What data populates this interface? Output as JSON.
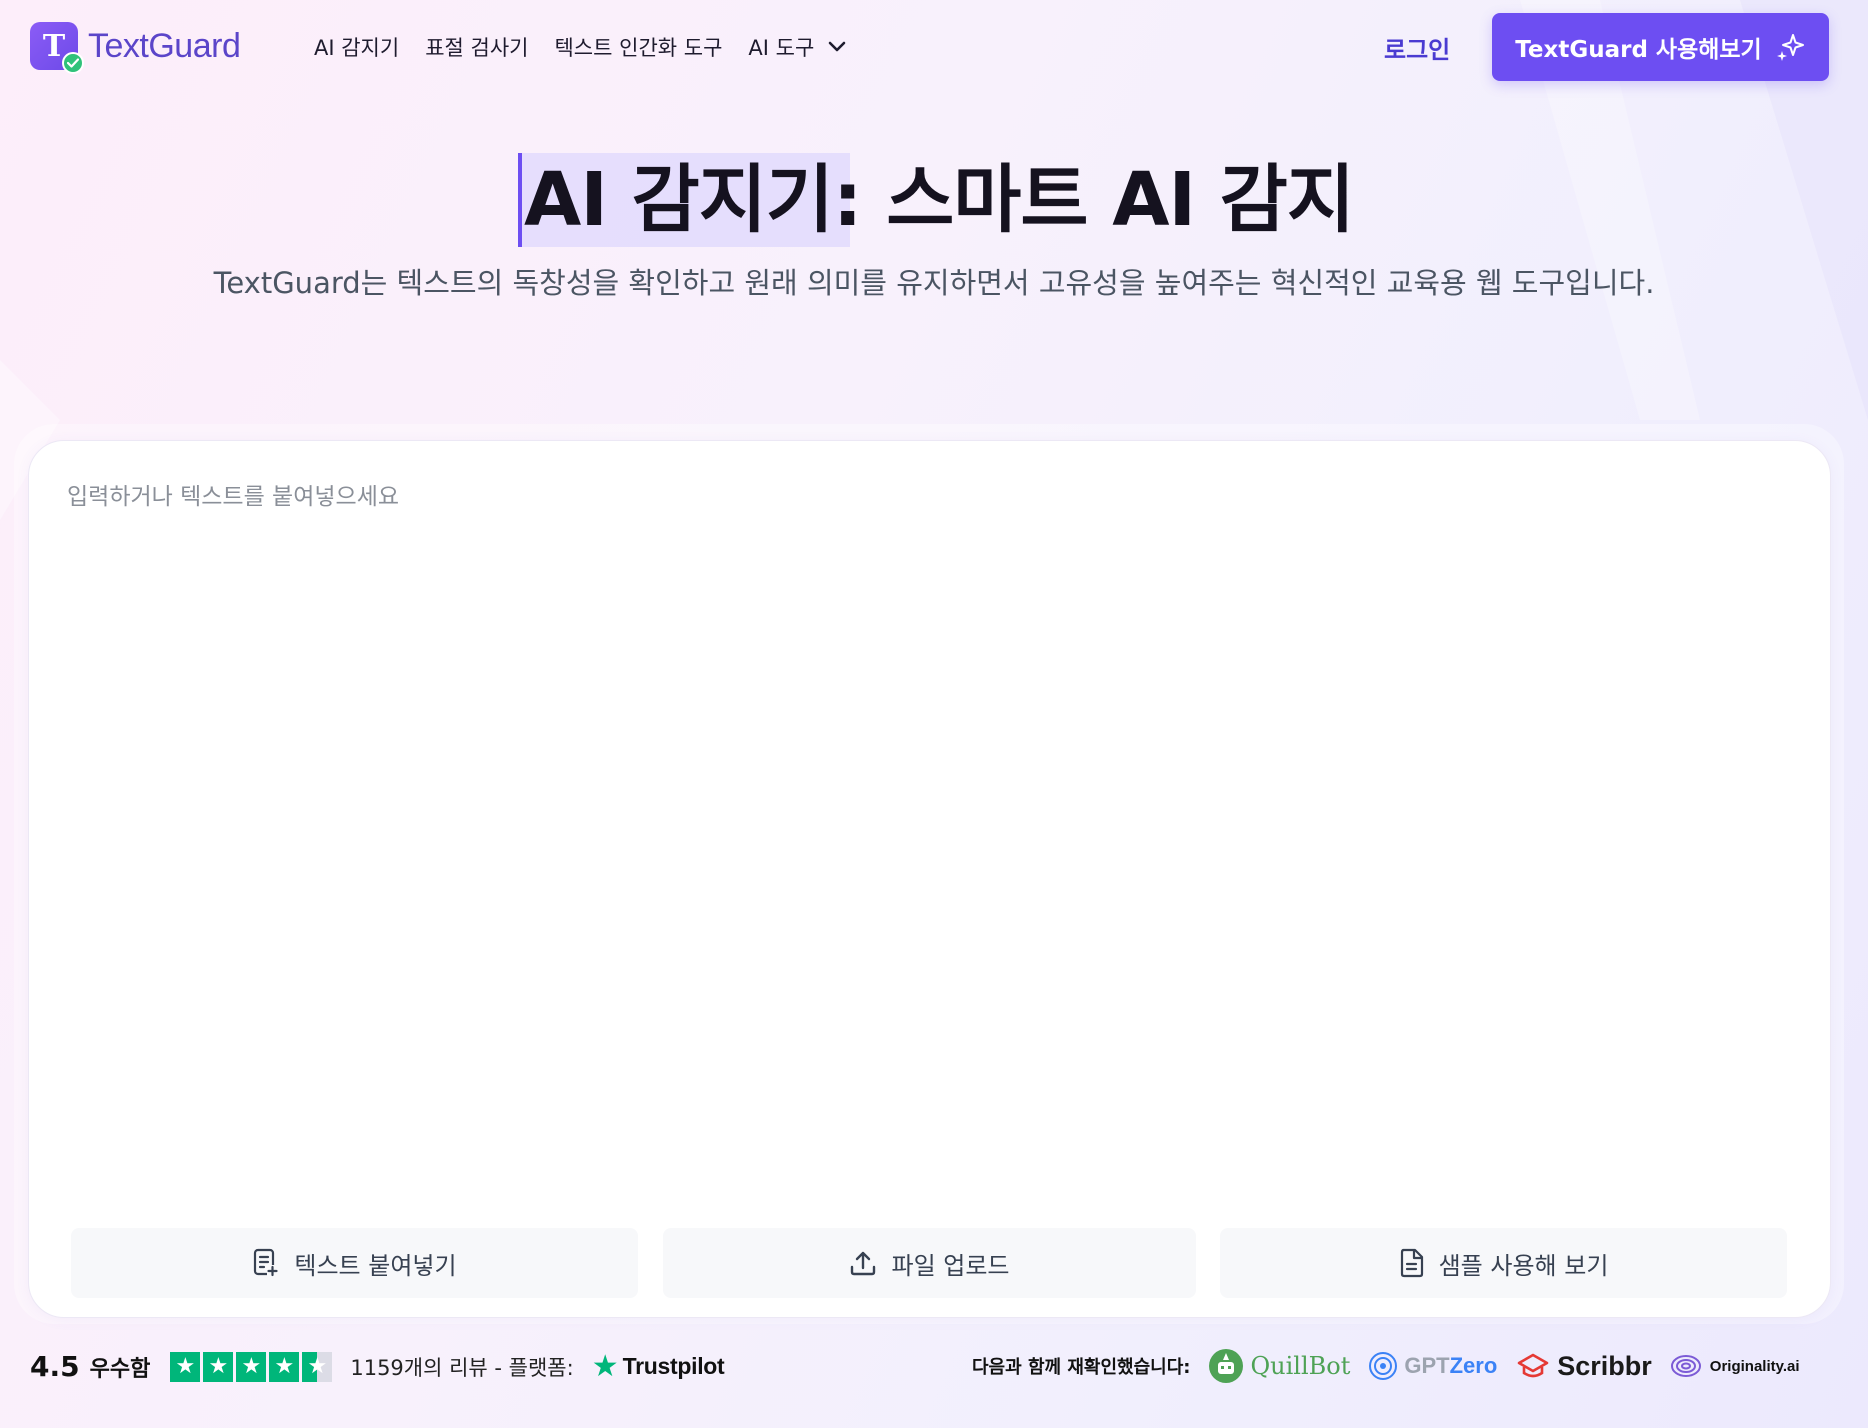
{
  "header": {
    "logo_text": "TextGuard",
    "nav": [
      "AI 감지기",
      "표절 검사기",
      "텍스트 인간화 도구",
      "AI 도구"
    ],
    "login_label": "로그인",
    "cta_label": "TextGuard 사용해보기"
  },
  "hero": {
    "title": "AI 감지기: 스마트 AI 감지",
    "subtitle": "TextGuard는 텍스트의 독창성을 확인하고 원래 의미를 유지하면서 고유성을 높여주는 혁신적인 교육용 웹 도구입니다."
  },
  "editor": {
    "placeholder": "입력하거나 텍스트를 붙여넣으세요",
    "actions": {
      "paste": "텍스트 붙여넣기",
      "upload": "파일 업로드",
      "sample": "샘플 사용해 보기"
    }
  },
  "footer": {
    "rating_score": "4.5",
    "rating_label": "우수함",
    "stars": 4.5,
    "reviews_text": "1159개의 리뷰 - 플랫폼:",
    "trustpilot": "Trustpilot",
    "verified_label": "다음과 함께 재확인했습니다:",
    "partners": {
      "quillbot": "QuillBot",
      "gptzero_a": "GPT",
      "gptzero_b": "Zero",
      "scribbr": "Scribbr",
      "originality": "Originality.ai"
    }
  },
  "colors": {
    "accent": "#6d4ef2",
    "login": "#4a3bd1",
    "trustpilot_green": "#00b67a"
  }
}
